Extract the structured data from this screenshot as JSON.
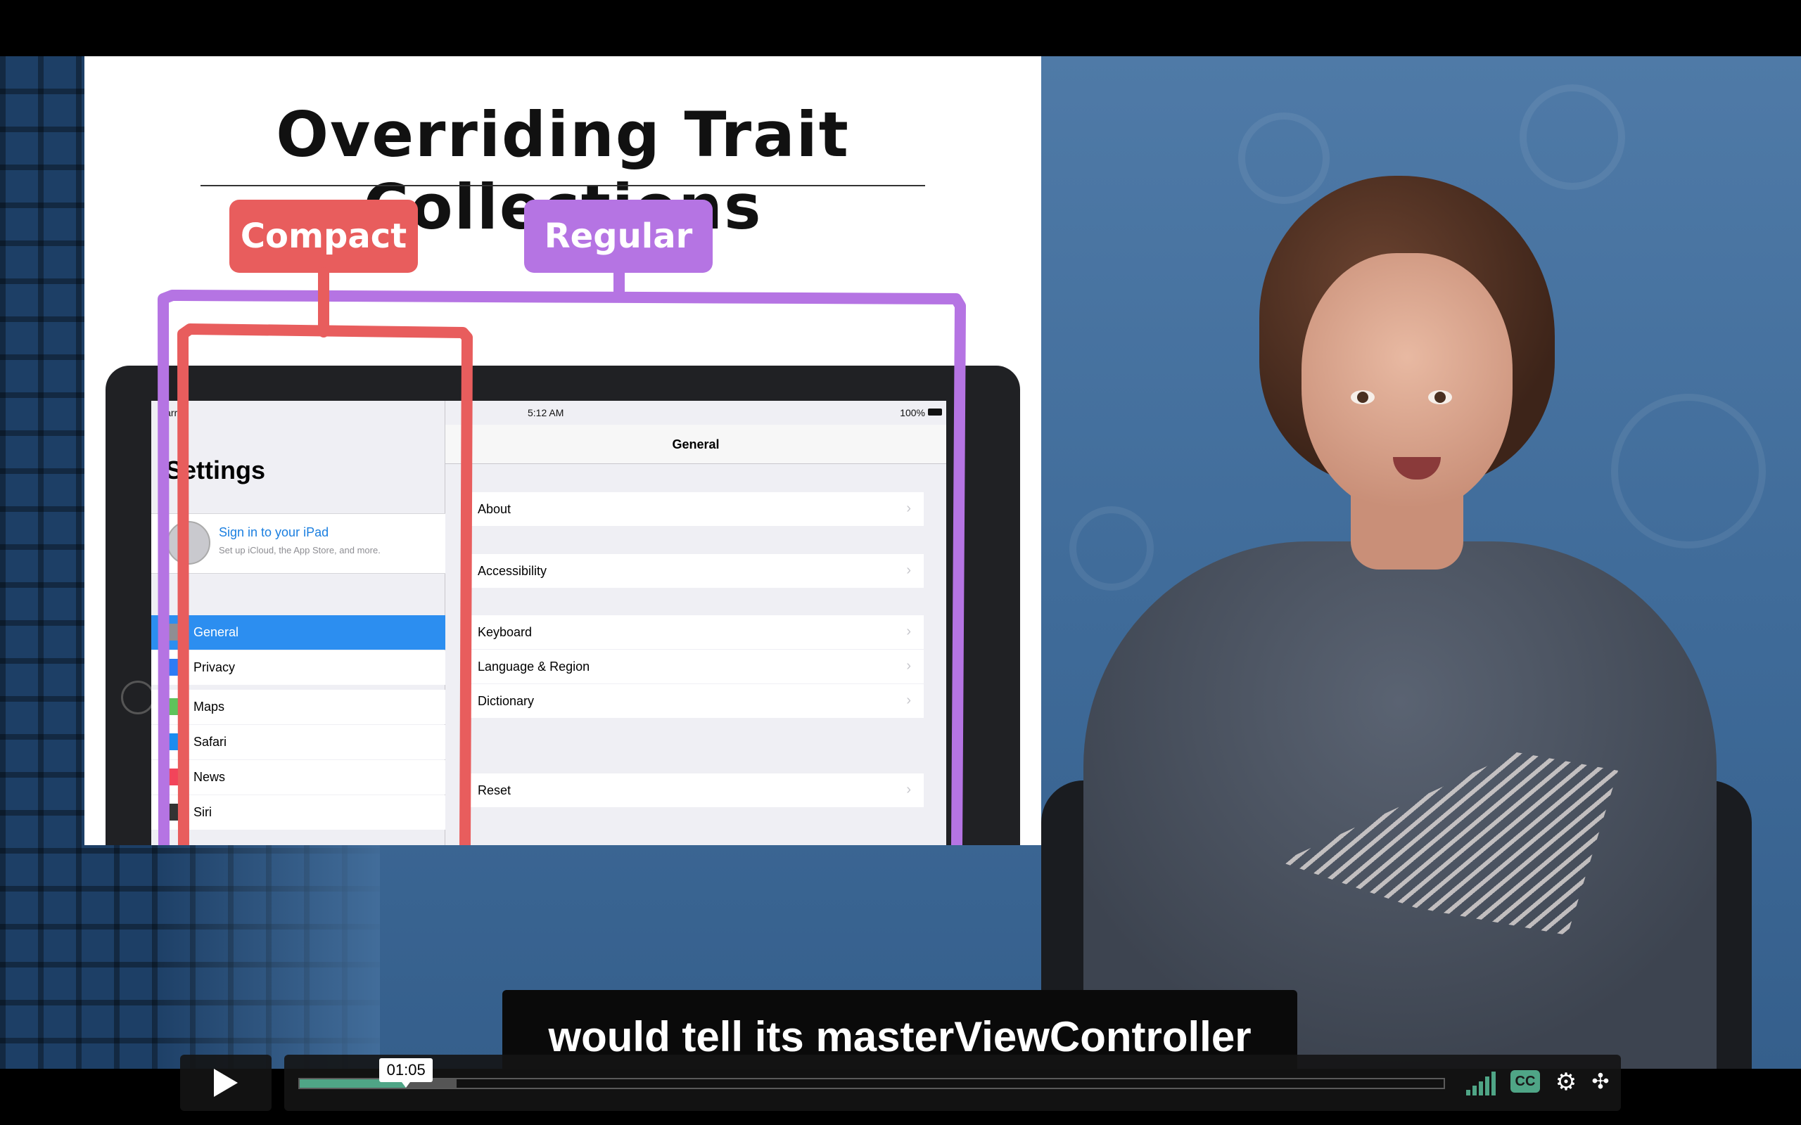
{
  "slide": {
    "title": "Overriding Trait Collections",
    "tag_compact": "Compact",
    "tag_regular": "Regular"
  },
  "ipad": {
    "status_carrier": "Carrier",
    "status_time": "5:12 AM",
    "status_battery": "100%",
    "master_title": "Settings",
    "signin_title": "Sign in to your iPad",
    "signin_subtitle": "Set up iCloud, the App Store, and more.",
    "master_items": [
      {
        "label": "General",
        "selected": true,
        "icon": "gear-icon",
        "color": "#8e8e93"
      },
      {
        "label": "Privacy",
        "selected": false,
        "icon": "hand-icon",
        "color": "#2c7cf6"
      },
      {
        "label": "Maps",
        "selected": false,
        "icon": "maps-icon",
        "color": "#5fc35b"
      },
      {
        "label": "Safari",
        "selected": false,
        "icon": "compass-icon",
        "color": "#1b8cf0"
      },
      {
        "label": "News",
        "selected": false,
        "icon": "news-icon",
        "color": "#f2445a"
      },
      {
        "label": "Siri",
        "selected": false,
        "icon": "siri-icon",
        "color": "#333333"
      }
    ],
    "detail_title": "General",
    "detail_items": [
      "About",
      "Accessibility",
      "Keyboard",
      "Language & Region",
      "Dictionary",
      "Reset"
    ]
  },
  "caption": "would tell its masterViewController",
  "player": {
    "time_tooltip": "01:05",
    "played_fraction": 0.093,
    "buffered_fraction": 0.137,
    "cc_label": "CC",
    "accent_color": "#4fa586"
  }
}
